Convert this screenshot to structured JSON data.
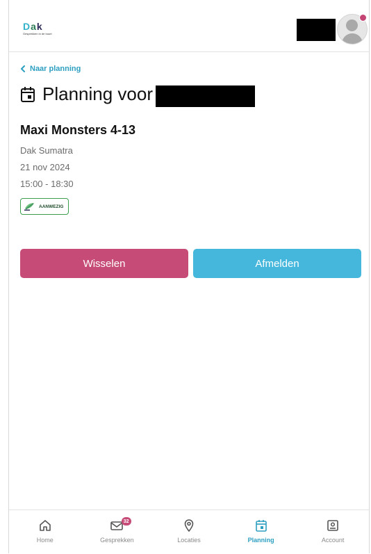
{
  "header": {
    "logo_text_d": "D",
    "logo_text_a": "a",
    "logo_text_k": "k",
    "logo_tagline": "Gesprekken in de buurt"
  },
  "back_link": "Naar planning",
  "page_title": "Planning voor",
  "event": {
    "title": "Maxi Monsters 4-13",
    "location": "Dak Sumatra",
    "date": "21 nov 2024",
    "time": "15:00 - 18:30",
    "status_badge": "AANWEZIG"
  },
  "buttons": {
    "swap": "Wisselen",
    "cancel": "Afmelden"
  },
  "nav": {
    "items": [
      {
        "label": "Home",
        "icon": "home-icon"
      },
      {
        "label": "Gesprekken",
        "icon": "mail-icon",
        "badge": "32"
      },
      {
        "label": "Locaties",
        "icon": "location-pin-icon"
      },
      {
        "label": "Planning",
        "icon": "calendar-icon",
        "active": true
      },
      {
        "label": "Account",
        "icon": "account-icon"
      }
    ]
  },
  "colors": {
    "accent_blue": "#45b7dc",
    "accent_pink": "#c64b76",
    "link_blue": "#2d9fc1",
    "badge_green": "#3a9d4a"
  }
}
